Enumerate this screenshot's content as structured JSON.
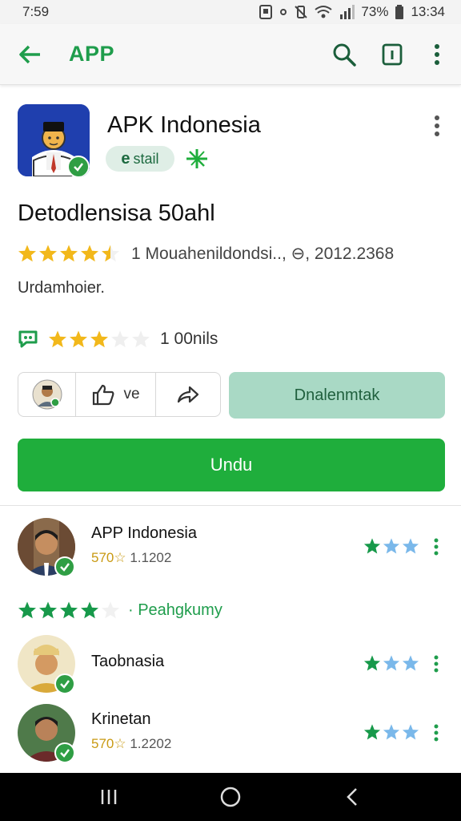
{
  "status_bar": {
    "time": "7:59",
    "battery_percent": "73%",
    "clock_right": "13:34"
  },
  "app_bar": {
    "title": "APP",
    "icons": [
      "back-arrow-icon",
      "search-icon",
      "info-icon",
      "more-vert-icon"
    ]
  },
  "app": {
    "name": "APK Indonesia",
    "install_chip_letter": "e",
    "install_chip_label": "stail",
    "subtitle": "Detodlensisa 50ahl",
    "rating_meta": "1 Mouahenildondsi.., ⊖, 2012.2368",
    "description": "Urdamhoier.",
    "review_count": "1 00nils",
    "rating_stars": 4.5,
    "review_stars": 3
  },
  "actions": {
    "like_label": "ve",
    "secondary_button": "Dnalenmtak",
    "primary_button": "Undu"
  },
  "list": [
    {
      "name": "APP Indonesia",
      "meta_rating": "570☆",
      "meta_count": "1.1202"
    },
    {
      "name": "Taobnasia",
      "meta_rating": "",
      "meta_count": ""
    },
    {
      "name": "Krinetan",
      "meta_rating": "570☆",
      "meta_count": "1.2202"
    }
  ],
  "rating_divider": {
    "label": "· Peahgkumy",
    "stars": 4
  },
  "colors": {
    "accent": "#1f9d4c",
    "primary_button": "#1fae3c",
    "secondary_button": "#a9d9c5",
    "star_gold": "#f2b81b",
    "star_green": "#17994a",
    "star_blue": "#7ab8ea"
  }
}
